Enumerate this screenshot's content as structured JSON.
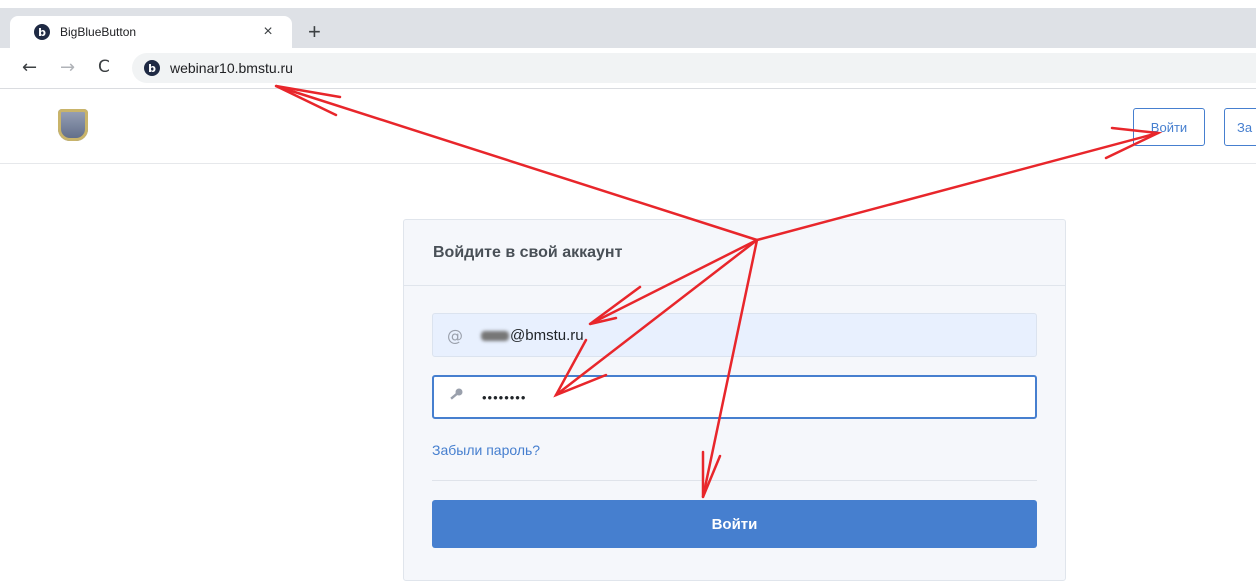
{
  "browser": {
    "tab": {
      "title": "BigBlueButton",
      "close_glyph": "×",
      "favicon_letter": "b"
    },
    "new_tab_glyph": "+",
    "nav": {
      "back": "←",
      "forward": "→",
      "reload": "C"
    },
    "url": "webinar10.bmstu.ru"
  },
  "header": {
    "logo": "crest-logo",
    "login_label": "Войти",
    "signup_label": "За"
  },
  "login_card": {
    "title": "Войдите в свой аккаунт",
    "email_icon": "@",
    "email_value": "@bmstu.ru",
    "password_value": "••••••••",
    "forgot_label": "Забыли пароль?",
    "submit_label": "Войти"
  },
  "annotations": {
    "color": "#e8262b",
    "type": "red-arrows"
  },
  "colors": {
    "accent": "#467fcf",
    "card_bg": "#f5f7fb",
    "autofill_bg": "#e8f0fe"
  }
}
